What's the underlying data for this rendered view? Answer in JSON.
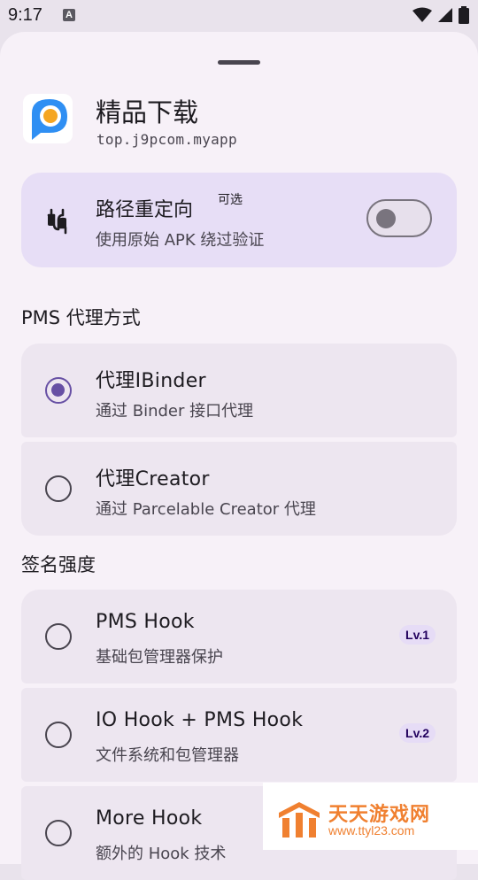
{
  "status_bar": {
    "time": "9:17",
    "notification_letter": "A"
  },
  "app": {
    "name": "精品下载",
    "package": "top.j9pcom.myapp"
  },
  "redirect": {
    "title": "路径重定向",
    "tag": "可选",
    "subtitle": "使用原始 APK 绕过验证",
    "toggle_on": false
  },
  "pms_section": {
    "title": "PMS 代理方式",
    "options": [
      {
        "title": "代理IBinder",
        "subtitle": "通过 Binder 接口代理",
        "selected": true
      },
      {
        "title": "代理Creator",
        "subtitle": "通过 Parcelable Creator 代理",
        "selected": false
      }
    ]
  },
  "sign_section": {
    "title": "签名强度",
    "options": [
      {
        "title": "PMS Hook",
        "subtitle": "基础包管理器保护",
        "badge": "Lv.1",
        "selected": false
      },
      {
        "title": "IO Hook + PMS Hook",
        "subtitle": "文件系统和包管理器",
        "badge": "Lv.2",
        "selected": false
      },
      {
        "title": "More Hook",
        "subtitle": "额外的 Hook 技术",
        "selected": false
      }
    ]
  },
  "watermark": {
    "name": "天天游戏网",
    "url": "www.ttyl23.com"
  },
  "colors": {
    "accent": "#6750a4",
    "card_highlight": "#e7def6",
    "option_bg": "#ede6f0"
  }
}
